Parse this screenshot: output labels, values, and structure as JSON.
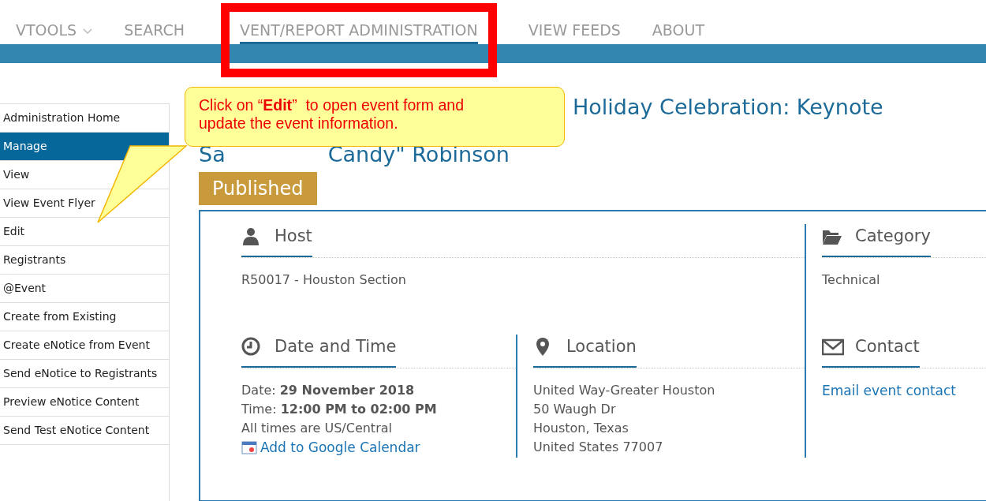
{
  "nav": [
    {
      "label": "VTOOLS",
      "dropdown": true,
      "selected": false
    },
    {
      "label": "SEARCH",
      "dropdown": false,
      "selected": false
    },
    {
      "label": "VENT/REPORT ADMINISTRATION",
      "dropdown": false,
      "selected": true
    },
    {
      "label": "VIEW FEEDS",
      "dropdown": false,
      "selected": false
    },
    {
      "label": "ABOUT",
      "dropdown": false,
      "selected": false
    }
  ],
  "sidebar": {
    "items": [
      {
        "label": "Administration Home",
        "selected": false
      },
      {
        "label": "Manage",
        "selected": true
      },
      {
        "label": "View",
        "selected": false
      },
      {
        "label": "View Event Flyer",
        "selected": false
      },
      {
        "label": "Edit",
        "selected": false
      },
      {
        "label": "Registrants",
        "selected": false
      },
      {
        "label": "@Event",
        "selected": false
      },
      {
        "label": "Create from Existing",
        "selected": false
      },
      {
        "label": "Create eNotice from Event",
        "selected": false
      },
      {
        "label": "Send eNotice to Registrants",
        "selected": false
      },
      {
        "label": "Preview eNotice Content",
        "selected": false
      },
      {
        "label": "Send Test eNotice Content",
        "selected": false
      }
    ]
  },
  "event": {
    "title_line_1": "Holiday Celebration: Keynote",
    "title_line_2_start": "Sa",
    "title_line_2_end": "Candy\" Robinson",
    "status": "Published",
    "sections": [
      {
        "kind": "host",
        "heading": "Host",
        "lines": [
          "R50017 - Houston Section"
        ]
      },
      {
        "kind": "category",
        "heading": "Category",
        "lines": [
          "Technical"
        ]
      },
      {
        "kind": "datetime",
        "heading": "Date and Time",
        "lines": [
          "Date: **29 November 2018**",
          "Time: **12:00 PM to 02:00 PM**",
          "All times are US/Central"
        ],
        "link": "Add to Google Calendar"
      },
      {
        "kind": "location",
        "heading": "Location",
        "lines": [
          "United Way-Greater Houston",
          "50 Waugh Dr",
          "Houston, Texas",
          "United States 77007"
        ]
      },
      {
        "kind": "contact",
        "heading": "Contact",
        "link": "Email event contact"
      }
    ]
  },
  "callout": {
    "text": "Click on “**Edit**”  to open event form and update the event information."
  }
}
